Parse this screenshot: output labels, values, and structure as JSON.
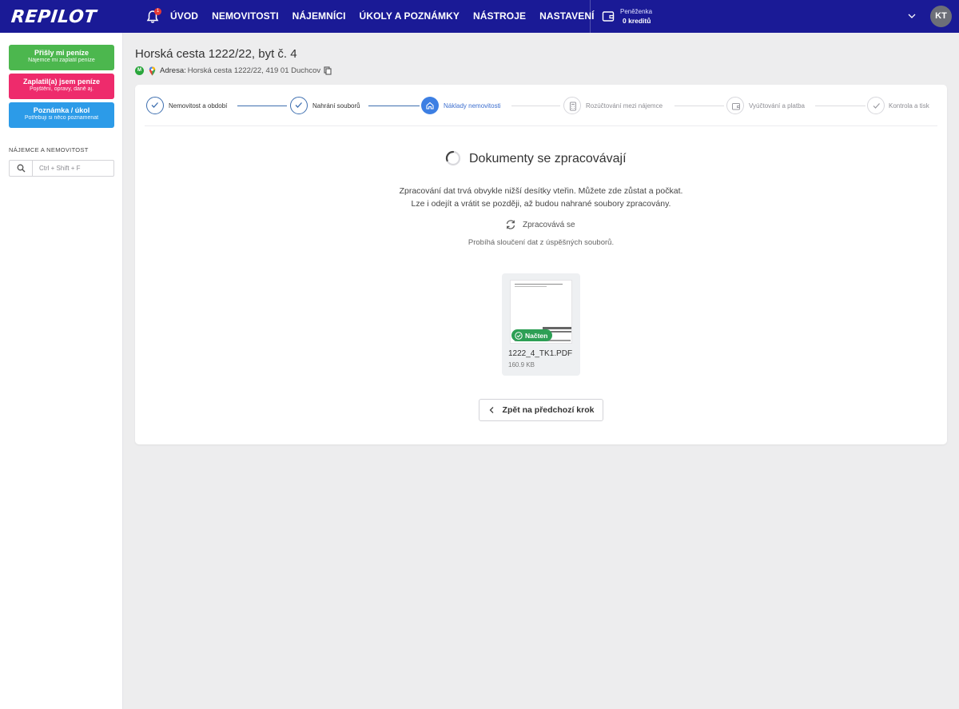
{
  "topbar": {
    "logo": "REPILOT",
    "notification_count": "1",
    "nav": [
      "ÚVOD",
      "NEMOVITOSTI",
      "NÁJEMNÍCI",
      "ÚKOLY A POZNÁMKY",
      "NÁSTROJE",
      "NASTAVENÍ"
    ],
    "wallet_label": "Peněženka",
    "wallet_value": "0 kreditů",
    "avatar_initials": "KT",
    "color": "#1a1a96"
  },
  "sidebar": {
    "buttons": [
      {
        "title": "Přišly mi peníze",
        "subtitle": "Nájemce mi zaplatil peníze",
        "color": "#4cb74e"
      },
      {
        "title": "Zaplatil(a) jsem peníze",
        "subtitle": "Pojištění, opravy, daně aj.",
        "color": "#ee2b6c"
      },
      {
        "title": "Poznámka / úkol",
        "subtitle": "Potřebuji si něco poznamenat",
        "color": "#2c9be8"
      }
    ],
    "section_heading": "NÁJEMCE A NEMOVITOST",
    "search_placeholder": "Ctrl + Shift + F"
  },
  "page": {
    "title": "Horská cesta 1222/22, byt č. 4",
    "badge": "M",
    "address_label": "Adresa:",
    "address_value": "Horská cesta 1222/22, 419 01 Duchcov"
  },
  "stepper": {
    "steps": [
      {
        "label": "Nemovitost a období",
        "state": "done"
      },
      {
        "label": "Nahrání souborů",
        "state": "done"
      },
      {
        "label": "Náklady nemovitosti",
        "state": "active"
      },
      {
        "label": "Rozúčtování mezi nájemce",
        "state": "pending"
      },
      {
        "label": "Vyúčtování a platba",
        "state": "pending"
      },
      {
        "label": "Kontrola a tisk",
        "state": "pending"
      }
    ]
  },
  "processing": {
    "title": "Dokumenty se zpracovávají",
    "description_line1": "Zpracování dat trvá obvykle nižší desítky vteřin. Můžete zde zůstat a počkat.",
    "description_line2": "Lze i odejít a vrátit se později, až budou nahrané soubory zpracovány.",
    "status": "Zpracovává se",
    "merge_text": "Probíhá sloučení dat z úspěšných souborů."
  },
  "file": {
    "badge": "Načten",
    "name": "1222_4_TK1.PDF",
    "size": "160.9 KB"
  },
  "actions": {
    "back_label": "Zpět na předchozí krok"
  }
}
